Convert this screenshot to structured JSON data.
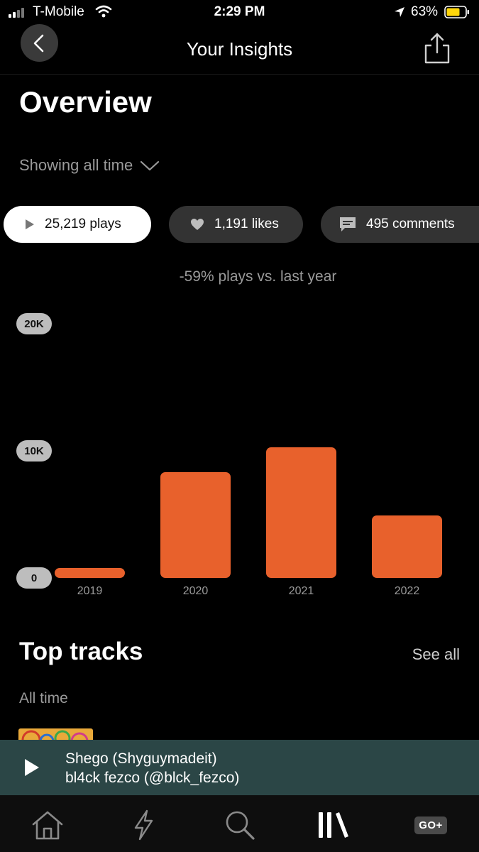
{
  "status_bar": {
    "carrier": "T-Mobile",
    "time": "2:29 PM",
    "battery_percent": "63%",
    "icons": [
      "signal-icon",
      "wifi-icon",
      "location-icon",
      "battery-icon"
    ]
  },
  "header": {
    "title": "Your Insights",
    "back_icon": "chevron-left-icon",
    "share_icon": "share-icon"
  },
  "overview": {
    "title": "Overview",
    "range_label": "Showing all time"
  },
  "metrics": [
    {
      "label": "25,219 plays",
      "icon": "play-icon",
      "selected": true
    },
    {
      "label": "1,191 likes",
      "icon": "heart-icon",
      "selected": false
    },
    {
      "label": "495 comments",
      "icon": "comment-icon",
      "selected": false
    }
  ],
  "comparison_text": "-59% plays vs. last year",
  "chart_data": {
    "type": "bar",
    "categories": [
      "2019",
      "2020",
      "2021",
      "2022"
    ],
    "values": [
      700,
      8300,
      10300,
      4900
    ],
    "y_ticks": [
      "0",
      "10K",
      "20K"
    ],
    "ylim": [
      0,
      20000
    ],
    "grid": false,
    "bar_color": "#e8612c"
  },
  "top_tracks": {
    "title": "Top tracks",
    "see_all": "See all",
    "subtitle": "All time"
  },
  "now_playing": {
    "title": "Shego (Shyguymadeit)",
    "artist": "bl4ck fezco (@blck_fezco)"
  },
  "tabs": [
    {
      "name": "home",
      "icon": "home-icon"
    },
    {
      "name": "feed",
      "icon": "lightning-icon"
    },
    {
      "name": "search",
      "icon": "search-icon"
    },
    {
      "name": "library",
      "icon": "library-icon",
      "active": true
    },
    {
      "name": "upgrade",
      "icon": "go-plus-badge",
      "label": "GO+"
    }
  ],
  "colors": {
    "accent": "#e8612c",
    "background": "#000000",
    "mini_player": "#2b4646"
  }
}
